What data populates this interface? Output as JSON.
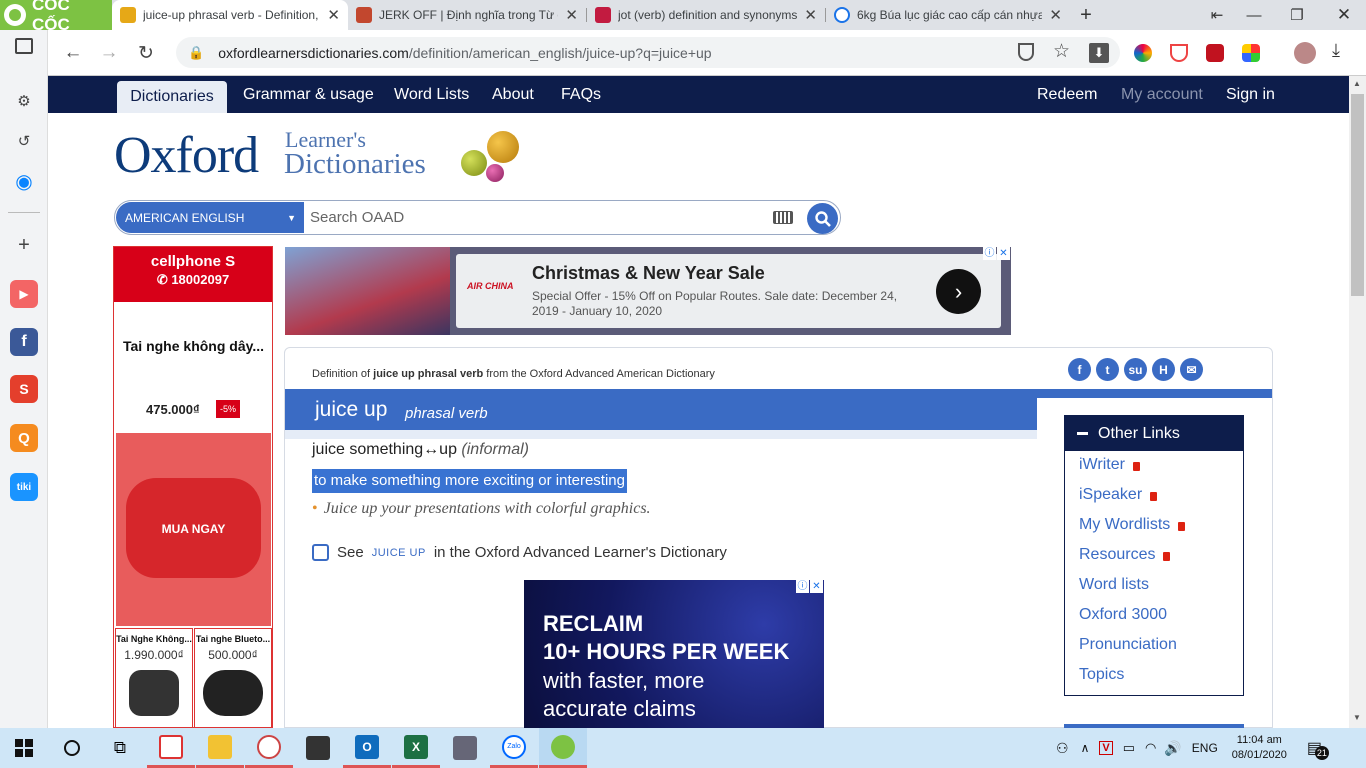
{
  "browser": {
    "brand": "CỐC CỐC",
    "tabs": [
      {
        "title": "juice-up phrasal verb - Definition, pictures, pronunciation",
        "active": true,
        "favicon_color": "#e6a817"
      },
      {
        "title": "JERK OFF | Định nghĩa trong Từ điển",
        "active": false,
        "favicon_color": "#c2472e"
      },
      {
        "title": "jot (verb) definition and synonyms",
        "active": false,
        "favicon_color": "#c21b40"
      },
      {
        "title": "6kg Búa lục giác cao cấp cán nhựa",
        "active": false,
        "favicon_color": "#1a73e8"
      }
    ],
    "new_tab": "+",
    "url_domain": "oxfordlearnersdictionaries.com",
    "url_path": "/definition/american_english/juice-up?q=juice+up"
  },
  "site": {
    "nav": [
      "Dictionaries",
      "Grammar & usage",
      "Word Lists",
      "About",
      "FAQs"
    ],
    "nav_right": {
      "redeem": "Redeem",
      "account": "My account",
      "signin": "Sign in"
    },
    "logo": {
      "oxford": "Oxford",
      "learners": "Learner's",
      "dictionaries": "Dictionaries"
    },
    "search": {
      "dictionary": "AMERICAN ENGLISH",
      "placeholder": "Search OAAD"
    }
  },
  "ads": {
    "left": {
      "brand": "cellphone S",
      "phone": "18002097",
      "product": "Tai nghe không dây...",
      "price": "475.000₫",
      "discount": "-5%",
      "cta": "MUA NGAY",
      "items": [
        {
          "name": "Tai Nghe Không...",
          "price": "1.990.000₫"
        },
        {
          "name": "Tai nghe Blueto...",
          "price": "500.000₫"
        }
      ]
    },
    "top": {
      "airline": "AIR CHINA",
      "headline": "Christmas & New Year Sale",
      "subtext": "Special Offer - 15% Off on Popular Routes. Sale date: December 24, 2019 - January 10, 2020"
    },
    "bottom": {
      "line1": "RECLAIM",
      "line2": "10+ HOURS PER WEEK",
      "line3": "with faster, more",
      "line4": "accurate claims"
    }
  },
  "entry": {
    "def_of_prefix": "Definition of",
    "def_of_word": "juice up phrasal verb",
    "def_of_suffix": "from the Oxford Advanced American Dictionary",
    "headword": "juice up",
    "pos": "phrasal verb",
    "use": "juice something↔up",
    "label": "informal",
    "definition": "to make something more exciting or interesting",
    "example": "Juice up your presentations with colorful graphics.",
    "see_prefix": "See",
    "see_word": "JUICE UP",
    "see_suffix": "in the Oxford Advanced Learner's Dictionary"
  },
  "other_links": {
    "title": "Other Links",
    "items": [
      {
        "label": "iWriter",
        "locked": true
      },
      {
        "label": "iSpeaker",
        "locked": true
      },
      {
        "label": "My Wordlists",
        "locked": true
      },
      {
        "label": "Resources",
        "locked": true
      },
      {
        "label": "Word lists",
        "locked": false
      },
      {
        "label": "Oxford 3000",
        "locked": false
      },
      {
        "label": "Pronunciation",
        "locked": false
      },
      {
        "label": "Topics",
        "locked": false
      }
    ]
  },
  "taskbar": {
    "lang": "ENG",
    "time": "11:04 am",
    "date": "08/01/2020",
    "notifications": "21"
  }
}
